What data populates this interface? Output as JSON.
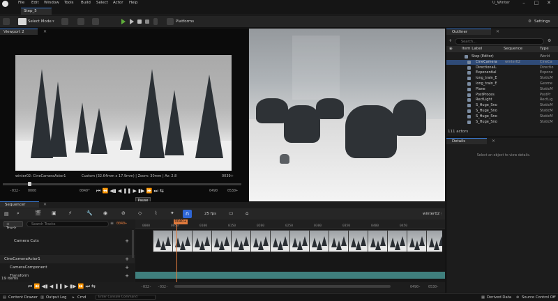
{
  "menu": {
    "items": [
      "File",
      "Edit",
      "Window",
      "Tools",
      "Build",
      "Select",
      "Actor",
      "Help"
    ],
    "project_name": "U_Winter"
  },
  "level_tab": "Step_5",
  "toolbar": {
    "select_mode": "Select Mode",
    "platforms": "Platforms",
    "settings": "Settings"
  },
  "viewport": {
    "tab": "Viewport 2",
    "camera_name": "winter02: CineCameraActor1",
    "camera_info": "Custom (32.64mm x 17.9mm) | Zoom: 30mm | Av: 2.8",
    "frame_right": "0039+",
    "time_start": "-032-",
    "time_in": "0000",
    "time_current": "0040*",
    "time_out": "0490",
    "time_end": "0530+",
    "transport": "⏮ ⏪ ◀▮ ◀ ❚❚ ▶ ▮▶ ⏩ ⏭ ⇆",
    "tooltip": "Pause"
  },
  "outliner": {
    "tab": "Outliner",
    "search_placeholder": "Search...",
    "col_label": "Item Label",
    "col_sequence": "Sequence",
    "col_type": "Type",
    "rows": [
      {
        "label": "Step (Editor)",
        "sequence": "",
        "type": "World"
      },
      {
        "label": "CineCamera",
        "sequence": "winter02",
        "type": "CineCa"
      },
      {
        "label": "DirectionalL",
        "sequence": "",
        "type": "Directio"
      },
      {
        "label": "Exponential",
        "sequence": "",
        "type": "Expone"
      },
      {
        "label": "long_train_E",
        "sequence": "",
        "type": "StaticM"
      },
      {
        "label": "long_train_E",
        "sequence": "",
        "type": "Geome"
      },
      {
        "label": "Plane",
        "sequence": "",
        "type": "StaticM"
      },
      {
        "label": "PostProces",
        "sequence": "",
        "type": "PostPr"
      },
      {
        "label": "RectLight",
        "sequence": "",
        "type": "RectLig"
      },
      {
        "label": "S_Huge_Sno",
        "sequence": "",
        "type": "StaticM"
      },
      {
        "label": "S_Huge_Sno",
        "sequence": "",
        "type": "StaticM"
      },
      {
        "label": "S_Huge_Sno",
        "sequence": "",
        "type": "StaticM"
      },
      {
        "label": "S_Huge_Sno",
        "sequence": "",
        "type": "StaticM"
      }
    ],
    "selected_index": 1,
    "count": "111 actors"
  },
  "details": {
    "tab": "Details",
    "empty_message": "Select an object to view details."
  },
  "sequencer": {
    "tab": "Sequencer",
    "fps": "25 fps",
    "sequence_name": "winter02",
    "add_track": "+ Track",
    "search_placeholder": "Search Tracks",
    "current_frame": "0040+",
    "playhead_label": "0040+",
    "ruler_ticks": [
      "0000",
      "0050",
      "0100",
      "0150",
      "0200",
      "0250",
      "0300",
      "0350",
      "0400",
      "0450"
    ],
    "tracks": [
      {
        "label": "Camera Cuts",
        "group": false
      },
      {
        "label": "CineCameraActor1",
        "group": true
      },
      {
        "label": "CameraComponent",
        "group": false
      },
      {
        "label": "Transform",
        "group": false
      }
    ],
    "items_count": "19 items",
    "bottom_start": "-032-",
    "bottom_in": "-032-",
    "bottom_out": "0490-",
    "bottom_end": "0530-",
    "transport": "⏮ ⏪ ◀▮ ◀ ❚❚ ▶ ▮▶ ⏩ ⏭ ⇆"
  },
  "statusbar": {
    "content_drawer": "Content Drawer",
    "output_log": "Output Log",
    "cmd": "Cmd",
    "cmd_placeholder": "Enter Console Command",
    "derived_data": "Derived Data",
    "source_control": "Source Control Off"
  },
  "colors": {
    "accent_blue": "#3a7bd5",
    "playhead_orange": "#e27b3d",
    "play_green": "#5fae3a",
    "teal_track": "#3f7f7d"
  }
}
